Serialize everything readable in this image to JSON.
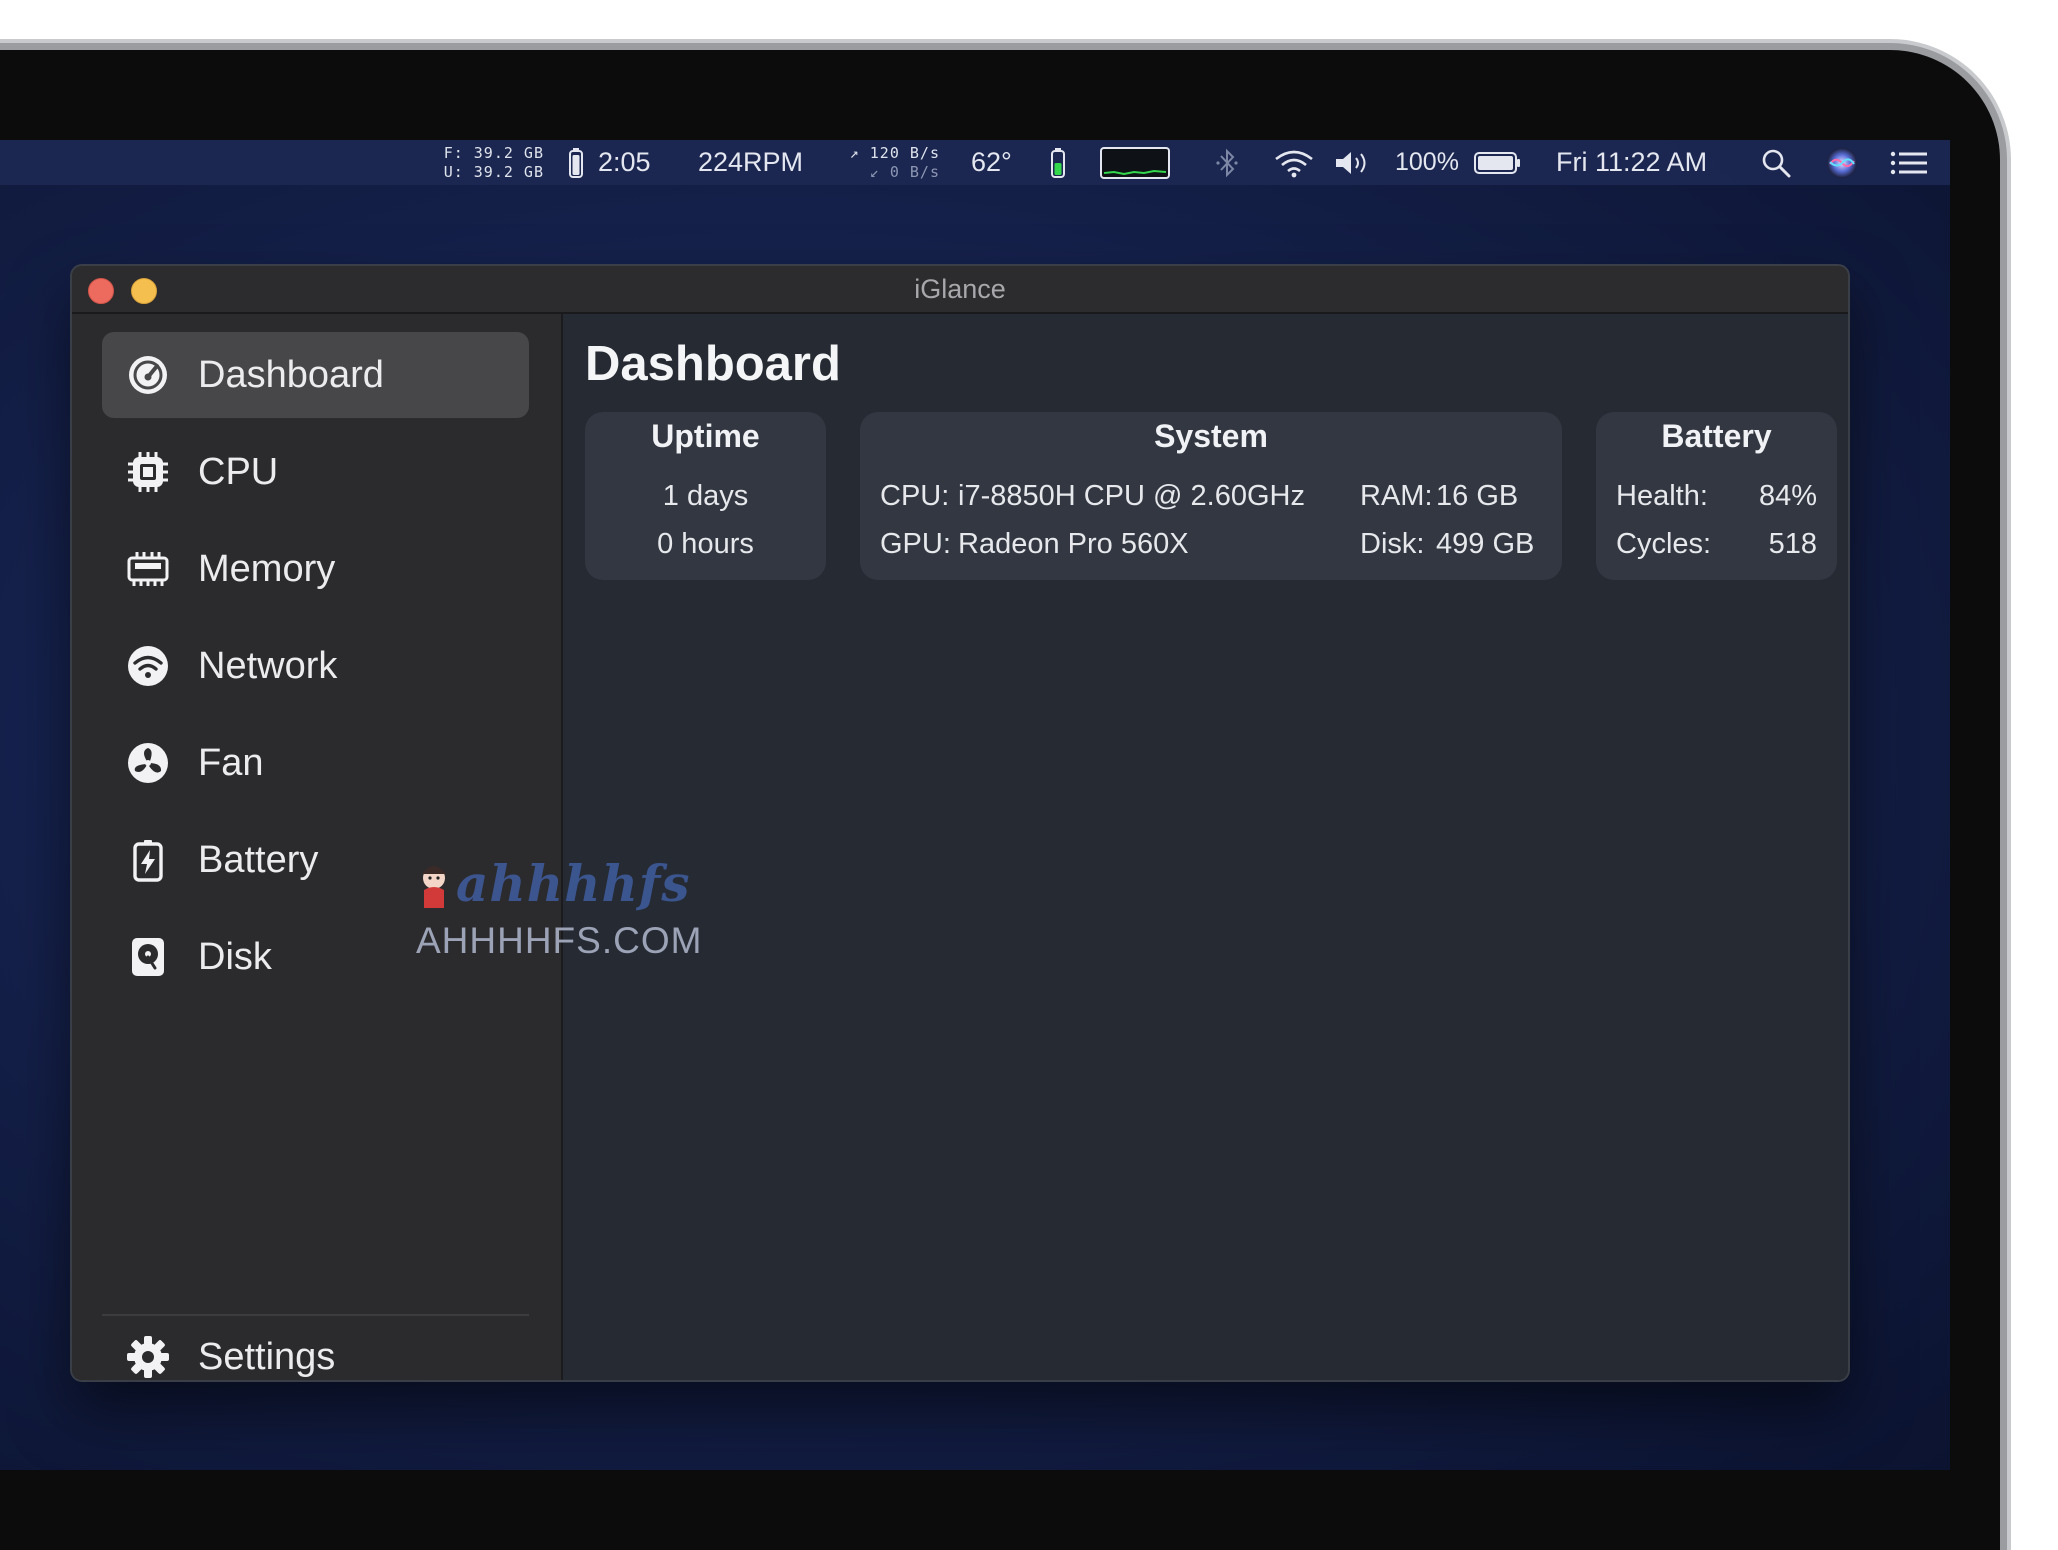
{
  "menubar": {
    "disk_free": "F: 39.2 GB",
    "disk_used": "U: 39.2 GB",
    "battery_time": "2:05",
    "fan_speed": "224RPM",
    "net_up": "120 B/s",
    "net_down": "0 B/s",
    "temperature": "62°",
    "battery_percent": "100%",
    "clock": "Fri 11:22 AM"
  },
  "window": {
    "title": "iGlance"
  },
  "sidebar": {
    "items": [
      {
        "label": "Dashboard",
        "icon": "dashboard-gauge-icon",
        "active": true
      },
      {
        "label": "CPU",
        "icon": "cpu-chip-icon",
        "active": false
      },
      {
        "label": "Memory",
        "icon": "memory-icon",
        "active": false
      },
      {
        "label": "Network",
        "icon": "wifi-icon",
        "active": false
      },
      {
        "label": "Fan",
        "icon": "fan-icon",
        "active": false
      },
      {
        "label": "Battery",
        "icon": "battery-icon",
        "active": false
      },
      {
        "label": "Disk",
        "icon": "disk-icon",
        "active": false
      }
    ],
    "settings_label": "Settings",
    "settings_icon": "gear-icon"
  },
  "main": {
    "title": "Dashboard",
    "uptime": {
      "header": "Uptime",
      "days": "1 days",
      "hours": "0 hours"
    },
    "system": {
      "header": "System",
      "cpu_label": "CPU:",
      "cpu_value": "i7-8850H CPU @ 2.60GHz",
      "gpu_label": "GPU:",
      "gpu_value": "Radeon Pro 560X",
      "ram_label": "RAM:",
      "ram_value": "16 GB",
      "disk_label": "Disk:",
      "disk_value": "499 GB"
    },
    "battery": {
      "header": "Battery",
      "health_label": "Health:",
      "health_value": "84%",
      "cycles_label": "Cycles:",
      "cycles_value": "518"
    }
  },
  "watermark": {
    "logo": "ahhhhfs",
    "text": "AHHHHFS.COM"
  },
  "colors": {
    "close": "#ed6a5e",
    "minimize": "#f5bf4f",
    "battery_green": "#32d74b",
    "sidebar_active": "#474749"
  }
}
